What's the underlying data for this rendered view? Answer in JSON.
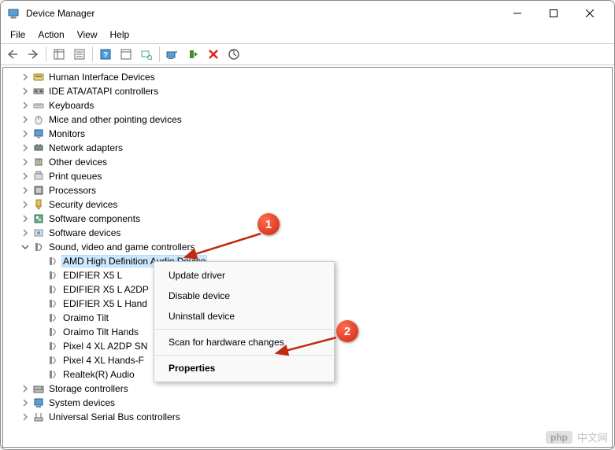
{
  "window": {
    "title": "Device Manager"
  },
  "menubar": [
    "File",
    "Action",
    "View",
    "Help"
  ],
  "callouts": {
    "one": "1",
    "two": "2"
  },
  "tree": {
    "items": [
      {
        "label": "Human Interface Devices",
        "expanded": false
      },
      {
        "label": "IDE ATA/ATAPI controllers",
        "expanded": false
      },
      {
        "label": "Keyboards",
        "expanded": false
      },
      {
        "label": "Mice and other pointing devices",
        "expanded": false
      },
      {
        "label": "Monitors",
        "expanded": false
      },
      {
        "label": "Network adapters",
        "expanded": false
      },
      {
        "label": "Other devices",
        "expanded": false
      },
      {
        "label": "Print queues",
        "expanded": false
      },
      {
        "label": "Processors",
        "expanded": false
      },
      {
        "label": "Security devices",
        "expanded": false
      },
      {
        "label": "Software components",
        "expanded": false
      },
      {
        "label": "Software devices",
        "expanded": false
      },
      {
        "label": "Sound, video and game controllers",
        "expanded": true,
        "children": [
          {
            "label": "AMD High Definition Audio Device",
            "selected": true
          },
          {
            "label": "EDIFIER X5 L"
          },
          {
            "label": "EDIFIER X5 L A2DP"
          },
          {
            "label": "EDIFIER X5 L Hand"
          },
          {
            "label": "Oraimo Tilt"
          },
          {
            "label": "Oraimo Tilt Hands"
          },
          {
            "label": "Pixel 4 XL A2DP SN"
          },
          {
            "label": "Pixel 4 XL Hands-F"
          },
          {
            "label": "Realtek(R) Audio"
          }
        ]
      },
      {
        "label": "Storage controllers",
        "expanded": false
      },
      {
        "label": "System devices",
        "expanded": false
      },
      {
        "label": "Universal Serial Bus controllers",
        "expanded": false
      }
    ]
  },
  "context_menu": {
    "items": [
      {
        "label": "Update driver"
      },
      {
        "label": "Disable device"
      },
      {
        "label": "Uninstall device"
      },
      {
        "sep": true
      },
      {
        "label": "Scan for hardware changes"
      },
      {
        "sep": true
      },
      {
        "label": "Properties",
        "bold": true
      }
    ]
  },
  "watermark": {
    "badge": "php",
    "text": "中文网"
  }
}
